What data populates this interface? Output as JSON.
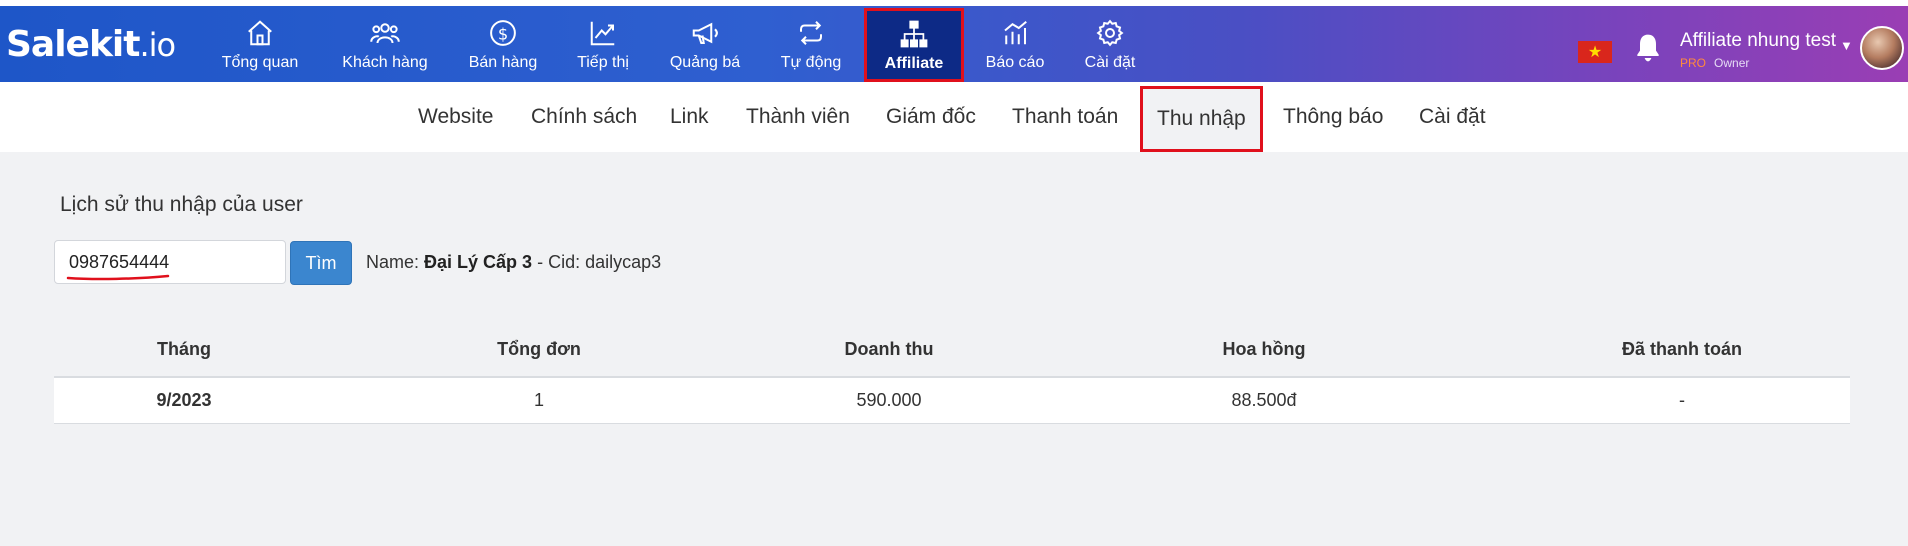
{
  "brand": {
    "logo_main": "Salekit",
    "logo_suffix": ".io"
  },
  "main_nav": [
    {
      "label": "Tổng quan",
      "icon": "home-icon"
    },
    {
      "label": "Khách hàng",
      "icon": "users-icon"
    },
    {
      "label": "Bán hàng",
      "icon": "dollar-icon"
    },
    {
      "label": "Tiếp thị",
      "icon": "trend-icon"
    },
    {
      "label": "Quảng bá",
      "icon": "megaphone-icon"
    },
    {
      "label": "Tự động",
      "icon": "repeat-icon"
    },
    {
      "label": "Affiliate",
      "icon": "sitemap-icon",
      "active": true
    },
    {
      "label": "Báo cáo",
      "icon": "chart-icon"
    },
    {
      "label": "Cài đặt",
      "icon": "gear-icon"
    }
  ],
  "user": {
    "name": "Affiliate nhung test",
    "plan": "PRO",
    "role": "Owner"
  },
  "sub_nav": [
    {
      "label": "Website"
    },
    {
      "label": "Chính sách"
    },
    {
      "label": "Link"
    },
    {
      "label": "Thành viên"
    },
    {
      "label": "Giám đốc"
    },
    {
      "label": "Thanh toán"
    },
    {
      "label": "Thu nhập",
      "active": true
    },
    {
      "label": "Thông báo"
    },
    {
      "label": "Cài đặt"
    }
  ],
  "page": {
    "title": "Lịch sử thu nhập của user",
    "search_value": "0987654444",
    "find_button": "Tìm",
    "user_info": {
      "name_label": "Name:",
      "name_value": "Đại Lý Cấp 3",
      "cid_text": "- Cid: dailycap3"
    }
  },
  "table": {
    "headers": [
      "Tháng",
      "Tổng đơn",
      "Doanh thu",
      "Hoa hồng",
      "Đã thanh toán"
    ],
    "rows": [
      [
        "9/2023",
        "1",
        "590.000",
        "88.500đ",
        "-"
      ]
    ]
  },
  "colors": {
    "accent_blue": "#1e56c8",
    "accent_purple": "#9a3eb4",
    "highlight_red": "#e0101c",
    "button_blue": "#3b86cf",
    "pro_orange": "#ff8a3d"
  }
}
